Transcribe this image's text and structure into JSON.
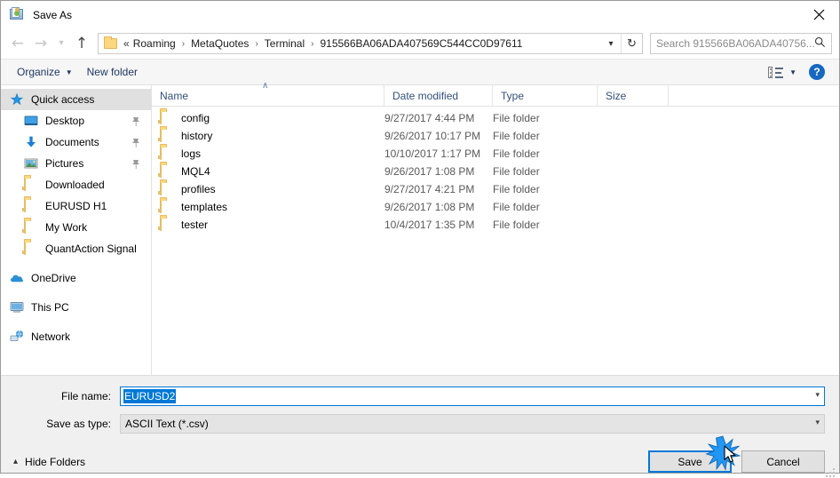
{
  "window": {
    "title": "Save As",
    "app_icon": "save-as-icon",
    "close_label": "✕"
  },
  "nav": {
    "back_icon": "back-arrow-icon",
    "forward_icon": "forward-arrow-icon",
    "recent_icon": "chevron-down-icon",
    "up_icon": "up-arrow-icon",
    "breadcrumb_lead": "«",
    "breadcrumbs": [
      "Roaming",
      "MetaQuotes",
      "Terminal",
      "915566BA06ADA407569C544CC0D97611"
    ],
    "separator": "›",
    "address_dropdown_icon": "chevron-down-icon",
    "refresh_icon": "↻"
  },
  "search": {
    "placeholder": "Search 915566BA06ADA40756...",
    "icon": "search-icon"
  },
  "toolbar": {
    "organize_label": "Organize",
    "organize_caret": "▼",
    "new_folder_label": "New folder",
    "view_icon": "view-options-icon",
    "view_caret": "▼",
    "help_label": "?"
  },
  "sidebar": {
    "items": [
      {
        "label": "Quick access",
        "icon": "star-icon",
        "selected": true,
        "pinned": false,
        "indent": false
      },
      {
        "label": "Desktop",
        "icon": "desktop-icon",
        "selected": false,
        "pinned": true,
        "indent": true
      },
      {
        "label": "Documents",
        "icon": "documents-download-icon",
        "selected": false,
        "pinned": true,
        "indent": true
      },
      {
        "label": "Pictures",
        "icon": "pictures-icon",
        "selected": false,
        "pinned": true,
        "indent": true
      },
      {
        "label": "Downloaded",
        "icon": "folder-icon",
        "selected": false,
        "pinned": false,
        "indent": true
      },
      {
        "label": "EURUSD H1",
        "icon": "folder-icon",
        "selected": false,
        "pinned": false,
        "indent": true
      },
      {
        "label": "My Work",
        "icon": "folder-icon",
        "selected": false,
        "pinned": false,
        "indent": true
      },
      {
        "label": "QuantAction Signal",
        "icon": "folder-icon",
        "selected": false,
        "pinned": false,
        "indent": true
      },
      {
        "label": "OneDrive",
        "icon": "onedrive-cloud-icon",
        "selected": false,
        "pinned": false,
        "indent": false,
        "gap_before": true
      },
      {
        "label": "This PC",
        "icon": "this-pc-icon",
        "selected": false,
        "pinned": false,
        "indent": false,
        "gap_before": true
      },
      {
        "label": "Network",
        "icon": "network-icon",
        "selected": false,
        "pinned": false,
        "indent": false,
        "gap_before": true
      }
    ]
  },
  "filelist": {
    "columns": [
      "Name",
      "Date modified",
      "Type",
      "Size"
    ],
    "sort_indicator": "∧",
    "rows": [
      {
        "name": "config",
        "date": "9/27/2017 4:44 PM",
        "type": "File folder",
        "size": ""
      },
      {
        "name": "history",
        "date": "9/26/2017 10:17 PM",
        "type": "File folder",
        "size": ""
      },
      {
        "name": "logs",
        "date": "10/10/2017 1:17 PM",
        "type": "File folder",
        "size": ""
      },
      {
        "name": "MQL4",
        "date": "9/26/2017 1:08 PM",
        "type": "File folder",
        "size": ""
      },
      {
        "name": "profiles",
        "date": "9/27/2017 4:21 PM",
        "type": "File folder",
        "size": ""
      },
      {
        "name": "templates",
        "date": "9/26/2017 1:08 PM",
        "type": "File folder",
        "size": ""
      },
      {
        "name": "tester",
        "date": "10/4/2017 1:35 PM",
        "type": "File folder",
        "size": ""
      }
    ]
  },
  "form": {
    "filename_label": "File name:",
    "filename_value": "EURUSD2",
    "filename_selected": true,
    "savetype_label": "Save as type:",
    "savetype_value": "ASCII Text (*.csv)",
    "dropdown_icon": "chevron-down-icon"
  },
  "footer": {
    "hide_folders_label": "Hide Folders",
    "hide_folders_icon": "chevron-up-icon",
    "save_label": "Save",
    "cancel_label": "Cancel",
    "resize_grip_icon": "resize-grip-icon",
    "cursor_icon": "mouse-pointer-icon",
    "click_burst_icon": "click-burst-icon"
  },
  "colors": {
    "accent": "#0078d7",
    "selection": "#0078d7",
    "folder": "#fcd77f",
    "link_text": "#1f3864",
    "help_blue": "#1668c1"
  }
}
